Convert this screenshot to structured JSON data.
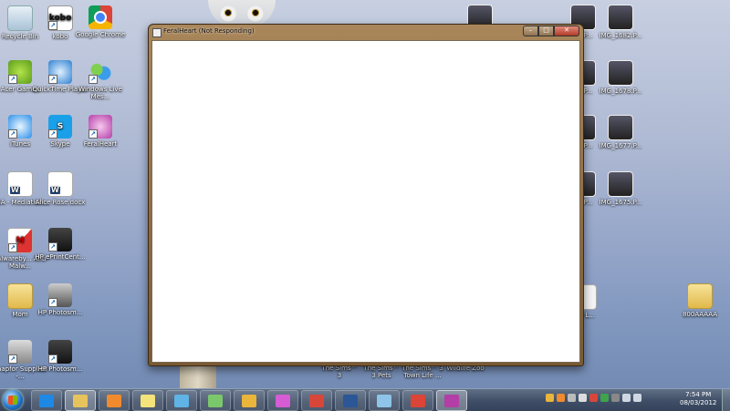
{
  "desktop": {
    "icons": [
      {
        "label": "Recycle Bin",
        "icon": "recycle-bin-icon"
      },
      {
        "label": "kobo",
        "icon": "kobo-icon",
        "glyph": "kobo"
      },
      {
        "label": "Google Chrome",
        "icon": "chrome-icon"
      },
      {
        "label": "Acer Games",
        "icon": "acer-games-icon"
      },
      {
        "label": "QuickTime Player",
        "icon": "quicktime-icon"
      },
      {
        "label": "Windows Live Mes...",
        "icon": "windows-live-messenger-icon"
      },
      {
        "label": "iTunes",
        "icon": "itunes-icon"
      },
      {
        "label": "Skype",
        "icon": "skype-icon",
        "glyph": "S"
      },
      {
        "label": "FeralHeart",
        "icon": "feralheart-icon"
      },
      {
        "label": "LISA - Mediation...",
        "icon": "word-document-icon"
      },
      {
        "label": "Alice Rose.docx",
        "icon": "word-document-icon"
      },
      {
        "label": "Malwareby... Anti-Malw...",
        "icon": "malwarebytes-icon",
        "glyph": "M"
      },
      {
        "label": "HP ePrintCent...",
        "icon": "hp-eprint-icon"
      },
      {
        "label": "Mom",
        "icon": "folder-icon"
      },
      {
        "label": "HP Photosm...",
        "icon": "hp-photosmart-icon"
      },
      {
        "label": "Snapfor Supplies -...",
        "icon": "printer-supplies-icon"
      },
      {
        "label": "HP Photosm...",
        "icon": "hp-photosmart-icon"
      },
      {
        "label": "800AAAAA",
        "icon": "folder-icon"
      }
    ],
    "right_files": [
      {
        "label": "...3P..."
      },
      {
        "label": "IMG_1682.P..."
      },
      {
        "label": "...3P..."
      },
      {
        "label": "IMG_1678.P..."
      },
      {
        "label": "...3P..."
      },
      {
        "label": "IMG_1677.P..."
      },
      {
        "label": "...3P..."
      },
      {
        "label": "IMG_1675.P..."
      },
      {
        "label": "...d L..."
      }
    ],
    "bottom_shortcuts": [
      {
        "label": "The Sims™ 3"
      },
      {
        "label": "The Sims™ 3 Pets"
      },
      {
        "label": "The Sims™ 3 Town Life ..."
      },
      {
        "label": "Wildlife Zoo"
      }
    ]
  },
  "window": {
    "title": "FeralHeart (Not Responding)",
    "min_symbol": "–",
    "max_symbol": "□",
    "close_symbol": "✕"
  },
  "taskbar": {
    "pinned": [
      {
        "icon": "internet-explorer-icon",
        "color": "#1e88e5"
      },
      {
        "icon": "file-explorer-icon",
        "color": "#e6c35c",
        "active": true
      },
      {
        "icon": "media-player-icon",
        "color": "#f08b2d"
      },
      {
        "icon": "sticky-notes-icon",
        "color": "#f4e27a"
      },
      {
        "icon": "network-icon",
        "color": "#5fb3e5"
      },
      {
        "icon": "paint-icon",
        "color": "#7bc86c"
      },
      {
        "icon": "task-manager-icon",
        "color": "#e9b53a"
      },
      {
        "icon": "picasa-icon",
        "color": "#d65cd6"
      },
      {
        "icon": "paint-brush-icon",
        "color": "#d8463a"
      },
      {
        "icon": "word-icon",
        "color": "#2b5797"
      },
      {
        "icon": "snipping-tool-icon",
        "color": "#8fc4e8"
      },
      {
        "icon": "chrome-icon",
        "color": "#db4437"
      },
      {
        "icon": "feralheart-icon",
        "color": "#b33ea6",
        "active": true
      }
    ],
    "clock_time": "7:54 PM",
    "clock_date": "08/03/2012"
  }
}
